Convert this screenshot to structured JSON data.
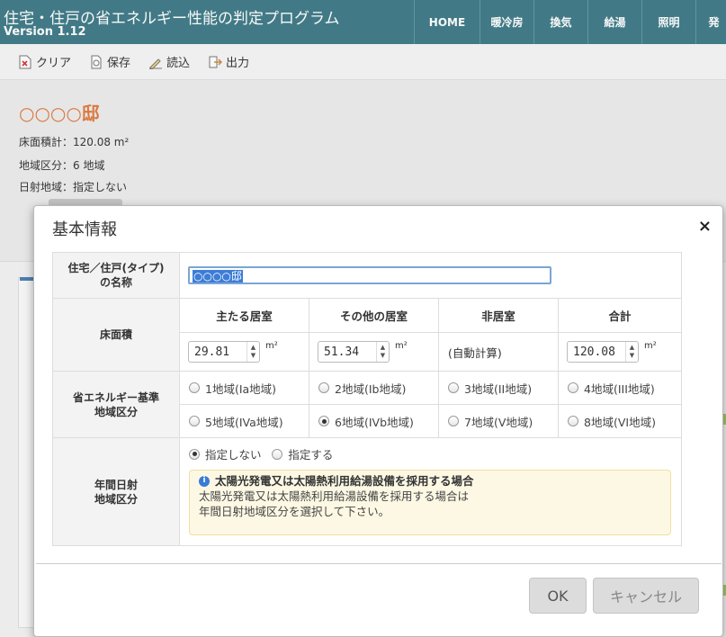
{
  "app": {
    "title": "住宅・住戸の省エネルギー性能の判定プログラム",
    "version": "Version 1.12"
  },
  "nav": [
    "HOME",
    "暖冷房",
    "換気",
    "給湯",
    "照明",
    "発"
  ],
  "toolbar": {
    "clear": "クリア",
    "save": "保存",
    "load": "読込",
    "output": "出力"
  },
  "page": {
    "house_name": "○○○○邸",
    "floor_area": "床面積計：120.08 m²",
    "region": "地域区分：6 地域",
    "solar_region": "日射地域：指定しない"
  },
  "dialog": {
    "title": "基本情報",
    "close": "×",
    "name_label_1": "住宅／住戸(タイプ)",
    "name_label_2": "の名称",
    "name_value": "○○○○邸",
    "floor_label": "床面積",
    "floor_cols": [
      "主たる居室",
      "その他の居室",
      "非居室",
      "合計"
    ],
    "floor_main": "29.81",
    "floor_other": "51.34",
    "floor_nonliving": "(自動計算)",
    "floor_total": "120.08",
    "unit": "m²",
    "region_label_1": "省エネルギー基準",
    "region_label_2": "地域区分",
    "regions": [
      "1地域(Ia地域)",
      "2地域(Ib地域)",
      "3地域(II地域)",
      "4地域(III地域)",
      "5地域(IVa地域)",
      "6地域(IVb地域)",
      "7地域(V地域)",
      "8地域(VI地域)"
    ],
    "selected_region": "6地域(IVb地域)",
    "solar_label_1": "年間日射",
    "solar_label_2": "地域区分",
    "solar_options": [
      "指定しない",
      "指定する"
    ],
    "solar_selected": "指定しない",
    "notice_title": "太陽光発電又は太陽熱利用給湯設備を採用する場合",
    "notice_line1": "太陽光発電又は太陽熱利用給湯設備を採用する場合は",
    "notice_line2": "年間日射地域区分を選択して下さい。",
    "ok": "OK",
    "cancel": "キャンセル"
  }
}
